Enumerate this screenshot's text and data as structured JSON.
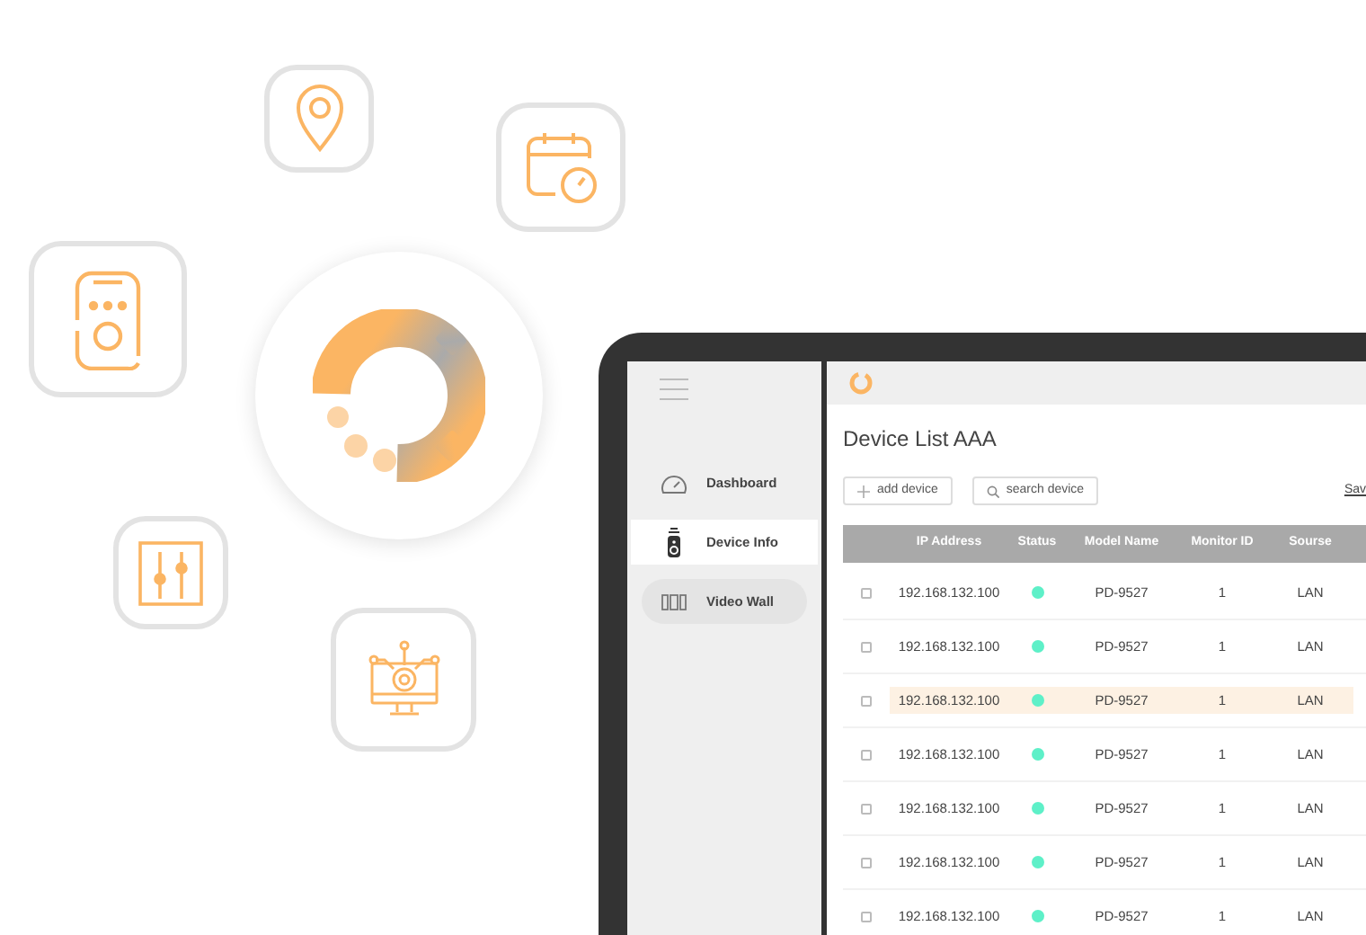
{
  "sidebar": {
    "items": [
      {
        "label": "Dashboard",
        "kind": "gauge",
        "selected": false,
        "hovered": false
      },
      {
        "label": "Device Info",
        "kind": "remote",
        "selected": true,
        "hovered": false
      },
      {
        "label": "Video Wall",
        "kind": "wall",
        "selected": false,
        "hovered": true
      }
    ]
  },
  "page": {
    "title": "Device List AAA",
    "add_button": "add device",
    "search_button": "search device",
    "save_link": "Sav"
  },
  "table": {
    "columns": [
      "IP Address",
      "Status",
      "Model Name",
      "Monitor ID",
      "Sourse"
    ],
    "rows": [
      {
        "checked": false,
        "selected": false,
        "online": true,
        "ip": "192.168.132.100",
        "model": "PD-9527",
        "monitor_id": "1",
        "source": "LAN"
      },
      {
        "checked": false,
        "selected": false,
        "online": true,
        "ip": "192.168.132.100",
        "model": "PD-9527",
        "monitor_id": "1",
        "source": "LAN"
      },
      {
        "checked": false,
        "selected": true,
        "online": true,
        "ip": "192.168.132.100",
        "model": "PD-9527",
        "monitor_id": "1",
        "source": "LAN"
      },
      {
        "checked": false,
        "selected": false,
        "online": true,
        "ip": "192.168.132.100",
        "model": "PD-9527",
        "monitor_id": "1",
        "source": "LAN"
      },
      {
        "checked": false,
        "selected": false,
        "online": true,
        "ip": "192.168.132.100",
        "model": "PD-9527",
        "monitor_id": "1",
        "source": "LAN"
      },
      {
        "checked": false,
        "selected": false,
        "online": true,
        "ip": "192.168.132.100",
        "model": "PD-9527",
        "monitor_id": "1",
        "source": "LAN"
      },
      {
        "checked": false,
        "selected": false,
        "online": true,
        "ip": "192.168.132.100",
        "model": "PD-9527",
        "monitor_id": "1",
        "source": "LAN"
      }
    ]
  }
}
